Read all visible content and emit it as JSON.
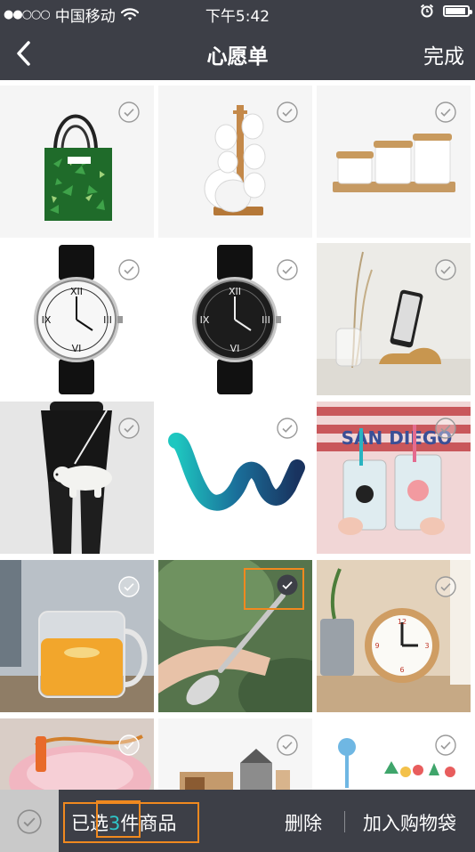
{
  "status_bar": {
    "carrier": "中国移动",
    "time": "下午5:42",
    "battery_level": 0.9
  },
  "nav": {
    "title": "心愿单",
    "done_label": "完成"
  },
  "items": [
    {
      "id": "tote-bag",
      "selected": false
    },
    {
      "id": "cup-rack",
      "selected": false
    },
    {
      "id": "ceramic-jars",
      "selected": false
    },
    {
      "id": "watch-white",
      "selected": false
    },
    {
      "id": "watch-black",
      "selected": false
    },
    {
      "id": "phone-stand",
      "selected": false
    },
    {
      "id": "bear-bag",
      "selected": false
    },
    {
      "id": "wave-logo",
      "selected": false
    },
    {
      "id": "tumblers",
      "selected": false
    },
    {
      "id": "glass-mug",
      "selected": false
    },
    {
      "id": "spoon",
      "selected": true
    },
    {
      "id": "alarm-clock",
      "selected": false
    },
    {
      "id": "pink-bowl",
      "selected": false
    },
    {
      "id": "house-decor",
      "selected": false
    },
    {
      "id": "cake-toppers",
      "selected": false
    }
  ],
  "bottom_bar": {
    "selected_prefix": "已选",
    "selected_count": "3",
    "selected_suffix_unit": "件",
    "selected_suffix_noun": "商品",
    "delete_label": "删除",
    "add_to_bag_label": "加入购物袋"
  },
  "colors": {
    "bar_background": "#3d3f47",
    "accent_count": "#2ec7c9",
    "highlight": "#f0891f"
  }
}
